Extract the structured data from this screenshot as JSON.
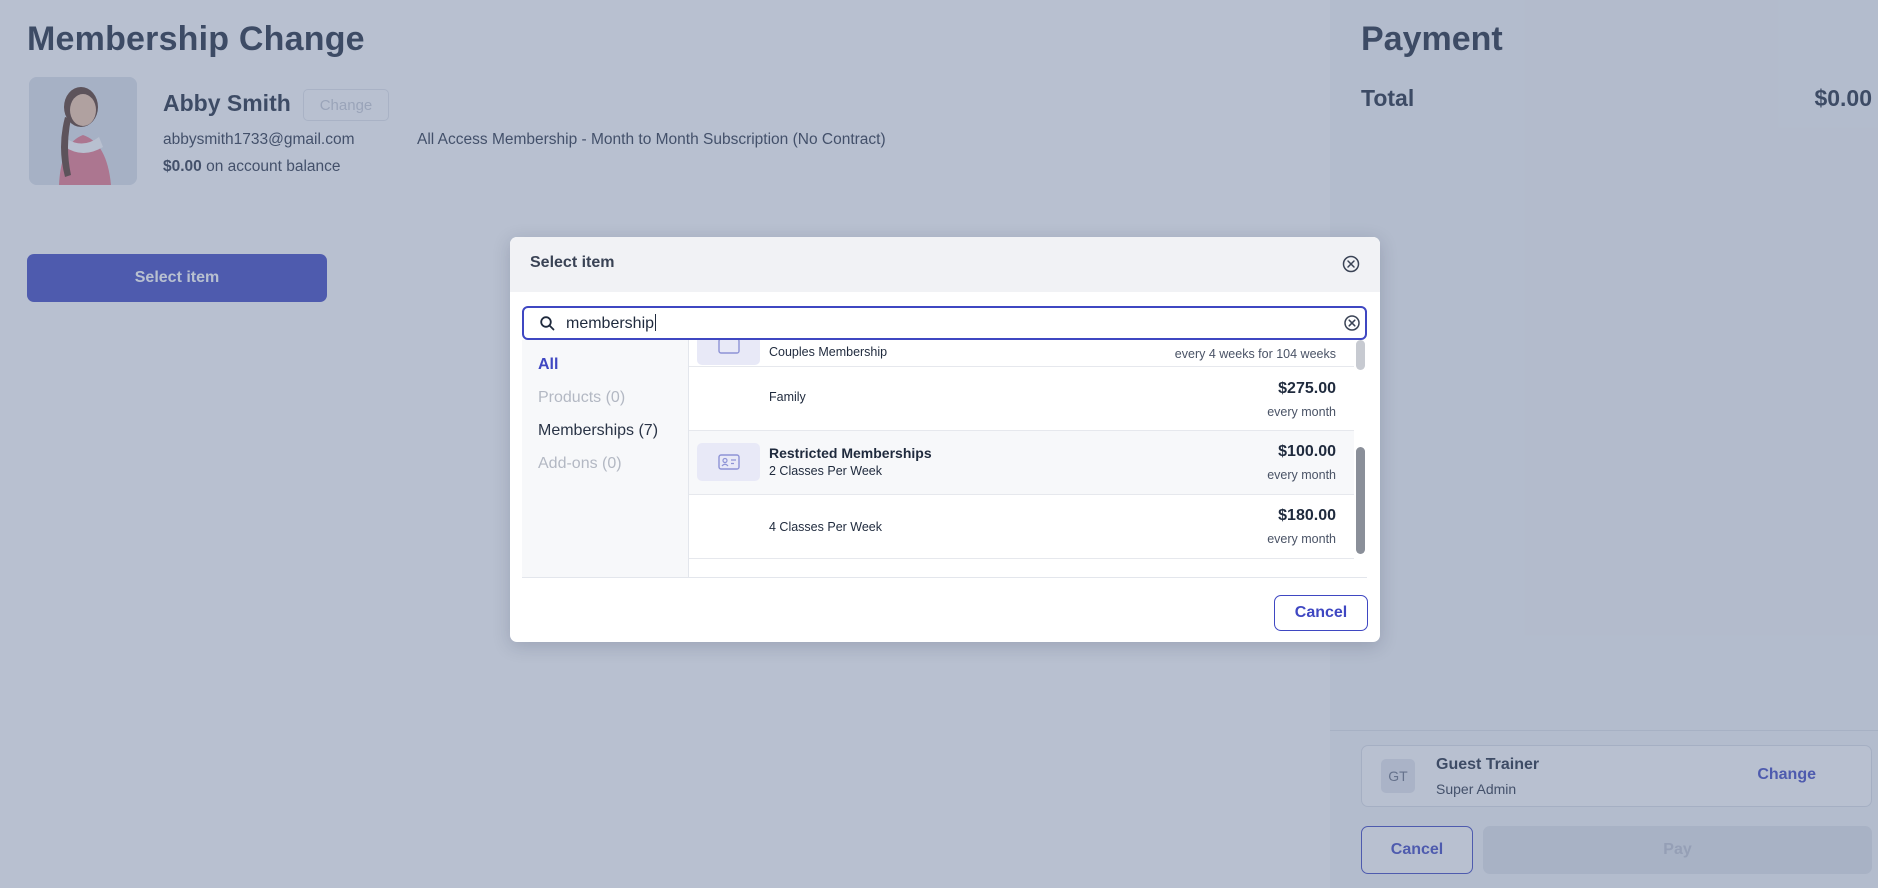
{
  "page": {
    "title": "Membership Change"
  },
  "member": {
    "name": "Abby Smith",
    "change_label": "Change",
    "email": "abbysmith1733@gmail.com",
    "plan": "All Access Membership - Month to Month Subscription (No Contract)",
    "balance_amount": "$0.00",
    "balance_suffix": "on account balance"
  },
  "actions": {
    "select_item_label": "Select item"
  },
  "payment": {
    "title": "Payment",
    "total_label": "Total",
    "total_value": "$0.00",
    "trainer_initials": "GT",
    "trainer_name": "Guest Trainer",
    "trainer_role": "Super Admin",
    "trainer_change_label": "Change",
    "cancel_label": "Cancel",
    "pay_label": "Pay"
  },
  "modal": {
    "title": "Select item",
    "search_value": "membership",
    "cancel_label": "Cancel",
    "categories": [
      {
        "label": "All",
        "state": "active"
      },
      {
        "label": "Products  (0)",
        "state": "disabled"
      },
      {
        "label": "Memberships  (7)",
        "state": "normal"
      },
      {
        "label": "Add-ons  (0)",
        "state": "disabled"
      }
    ],
    "items": [
      {
        "title": "",
        "subtitle": "Couples Membership",
        "price": "",
        "frequency": "every 4 weeks for 104 weeks"
      },
      {
        "title": "",
        "subtitle": "Family",
        "price": "$275.00",
        "frequency": "every month"
      },
      {
        "title": "Restricted Memberships",
        "subtitle": "2 Classes Per Week",
        "price": "$100.00",
        "frequency": "every month"
      },
      {
        "title": "",
        "subtitle": "4 Classes Per Week",
        "price": "$180.00",
        "frequency": "every month"
      }
    ]
  },
  "colors": {
    "accent": "#3f47c2",
    "overlay": "#62739673",
    "text": "#1f2a3d"
  }
}
